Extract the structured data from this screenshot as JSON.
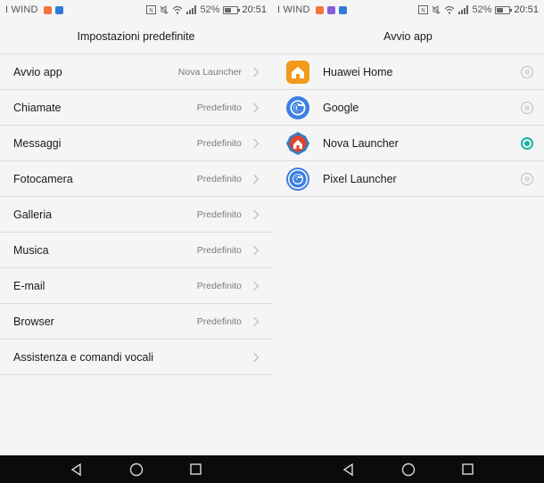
{
  "left_screen": {
    "status": {
      "carrier": "I WIND",
      "battery": "52%",
      "battery_level": 0.52,
      "time": "20:51"
    },
    "title": "Impostazioni predefinite",
    "items": [
      {
        "label": "Avvio app",
        "value": "Nova Launcher"
      },
      {
        "label": "Chiamate",
        "value": "Predefinito"
      },
      {
        "label": "Messaggi",
        "value": "Predefinito"
      },
      {
        "label": "Fotocamera",
        "value": "Predefinito"
      },
      {
        "label": "Galleria",
        "value": "Predefinito"
      },
      {
        "label": "Musica",
        "value": "Predefinito"
      },
      {
        "label": "E-mail",
        "value": "Predefinito"
      },
      {
        "label": "Browser",
        "value": "Predefinito"
      },
      {
        "label": "Assistenza e comandi vocali",
        "value": ""
      }
    ]
  },
  "right_screen": {
    "status": {
      "carrier": "I WIND",
      "battery": "52%",
      "battery_level": 0.52,
      "time": "20:51"
    },
    "title": "Avvio app",
    "apps": [
      {
        "label": "Huawei Home",
        "icon": "huawei-home-icon",
        "selected": false
      },
      {
        "label": "Google",
        "icon": "google-icon",
        "selected": false
      },
      {
        "label": "Nova Launcher",
        "icon": "nova-launcher-icon",
        "selected": true
      },
      {
        "label": "Pixel Launcher",
        "icon": "pixel-launcher-icon",
        "selected": false
      }
    ]
  },
  "colors": {
    "accent": "#19b4a4",
    "background": "#f5f5f5",
    "divider": "#dcdcdc",
    "navbar": "#0b0b0b"
  },
  "navbar": {
    "icons": [
      "back-icon",
      "home-icon",
      "recents-icon"
    ]
  }
}
